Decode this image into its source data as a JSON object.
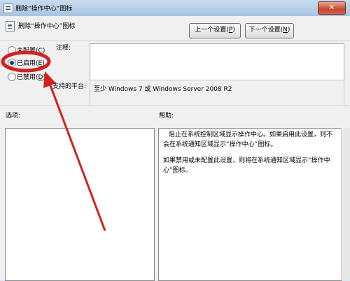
{
  "window": {
    "title": "删除“操作中心”图标",
    "close_label": "✕"
  },
  "header": {
    "policy_title": "删除“操作中心”图标",
    "prev_label": "上一个设置(",
    "prev_key": "P",
    "prev_tail": ")",
    "next_label": "下一个设置(",
    "next_key": "N",
    "next_tail": ")"
  },
  "options": [
    {
      "label": "未配置(",
      "key": "C",
      "tail": ")",
      "checked": false
    },
    {
      "label": "已启用(",
      "key": "E",
      "tail": ")",
      "checked": true
    },
    {
      "label": "已禁用(",
      "key": "D",
      "tail": ")",
      "checked": false
    }
  ],
  "comment": {
    "label": "注释:",
    "value": ""
  },
  "platform": {
    "label": "支持的平台:",
    "value": "至少 Windows 7 或 Windows Server 2008 R2"
  },
  "panes": {
    "options_label": "选项:",
    "help_label": "帮助:",
    "help_paragraphs": [
      "阻止在系统控制区域显示操作中心。如果启用此设置，则不会在系统通知区域显示“操作中心”图标。",
      "如果禁用或未配置此设置，则将在系统通知区域显示“操作中心”图标。"
    ]
  },
  "annotation": {
    "color": "#d42020"
  }
}
